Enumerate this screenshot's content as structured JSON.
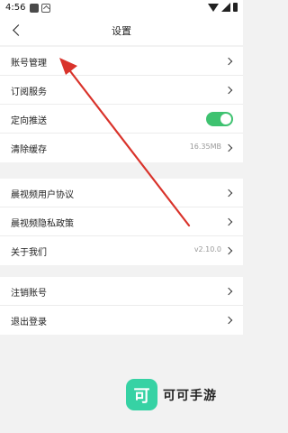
{
  "status_bar": {
    "time": "4:56"
  },
  "header": {
    "title": "设置"
  },
  "groups": [
    {
      "items": [
        {
          "label": "账号管理"
        },
        {
          "label": "订阅服务"
        },
        {
          "label": "定向推送",
          "toggle_on": true
        },
        {
          "label": "清除缓存",
          "value": "16.35MB"
        }
      ]
    },
    {
      "items": [
        {
          "label": "晨视频用户协议"
        },
        {
          "label": "晨视频隐私政策"
        },
        {
          "label": "关于我们",
          "value": "v2.10.0"
        }
      ]
    },
    {
      "items": [
        {
          "label": "注销账号"
        },
        {
          "label": "退出登录"
        }
      ]
    }
  ],
  "watermark": {
    "logo_char": "可",
    "text": "可可手游"
  },
  "colors": {
    "toggle_on": "#3ec270",
    "annotation_arrow": "#d9332b",
    "watermark_logo": "#36d2a4"
  },
  "icons": {
    "back": "chevron-left-icon",
    "row": "chevron-right-icon"
  }
}
